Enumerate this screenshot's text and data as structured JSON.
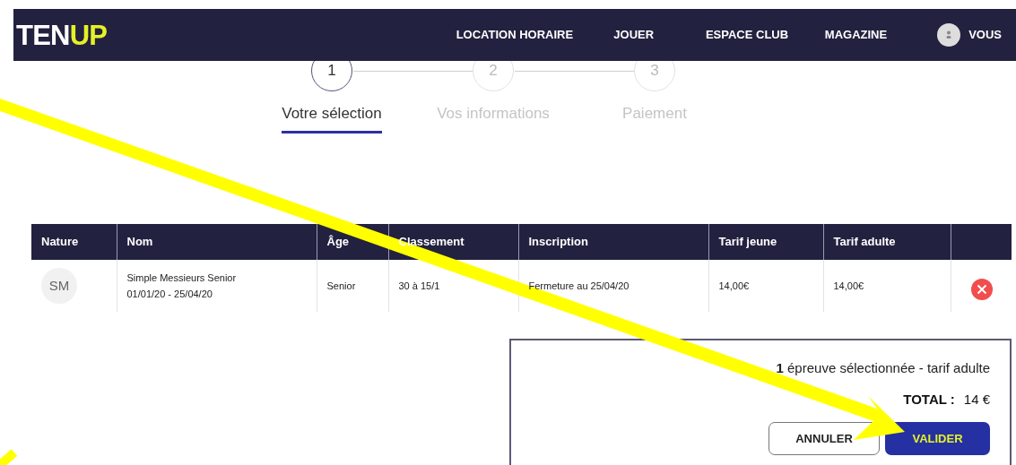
{
  "header": {
    "logo_left": "TEN",
    "logo_right": "UP",
    "nav": [
      "LOCATION HORAIRE",
      "JOUER",
      "ESPACE CLUB",
      "MAGAZINE"
    ],
    "user": "VOUS"
  },
  "steps": [
    {
      "number": "1",
      "label": "Votre sélection",
      "selected": true
    },
    {
      "number": "2",
      "label": "Vos informations",
      "selected": false
    },
    {
      "number": "3",
      "label": "Paiement",
      "selected": false
    }
  ],
  "table": {
    "columns": [
      "Nature",
      "Nom",
      "Âge",
      "Classement",
      "Inscription",
      "Tarif jeune",
      "Tarif adulte"
    ],
    "rows": [
      {
        "nature": "SM",
        "name": "Simple Messieurs Senior",
        "dates": "01/01/20 - 25/04/20",
        "age": "Senior",
        "classement": "30 à 15/1",
        "inscription": "Fermeture au 25/04/20",
        "tarif_jeune": "14,00€",
        "tarif_adulte": "14,00€"
      }
    ]
  },
  "summary": {
    "selection": "**1** épreuve sélectionnée - tarif adulte",
    "total_label": "TOTAL :",
    "total_value": "14 €",
    "buttons": [
      {
        "label": "ANNULER",
        "kind": "secondary"
      },
      {
        "label": "VALIDER",
        "kind": "primary"
      }
    ]
  }
}
